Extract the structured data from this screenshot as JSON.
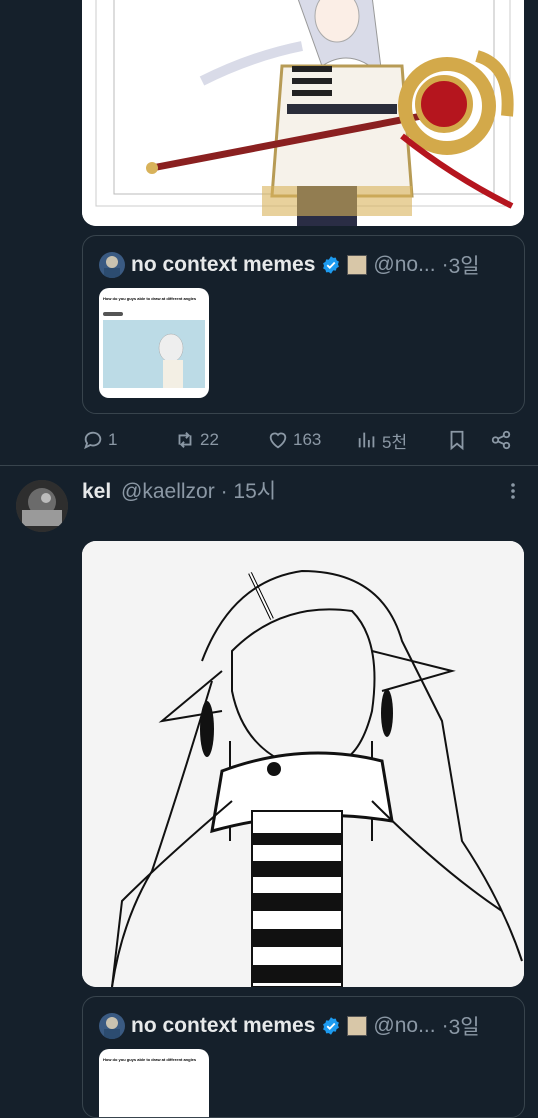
{
  "post1": {
    "quote": {
      "name": "no context memes",
      "handle": "@no...",
      "separator": "·",
      "time": "3일",
      "thumb_text": "How do you guys able to draw at different angles"
    },
    "actions": {
      "replies": "1",
      "reposts": "22",
      "likes": "163",
      "views": "5천"
    }
  },
  "post2": {
    "name": "kel",
    "handle": "@kaellzor",
    "separator": "·",
    "time": "15시",
    "quote": {
      "name": "no context memes",
      "handle": "@no...",
      "separator": "·",
      "time": "3일",
      "thumb_text": "How do you guys able to draw at different angles"
    }
  },
  "colors": {
    "background": "#15202b",
    "text": "#e7e9ea",
    "muted": "#8b98a5",
    "border": "#38444d",
    "verified": "#1d9bf0"
  }
}
